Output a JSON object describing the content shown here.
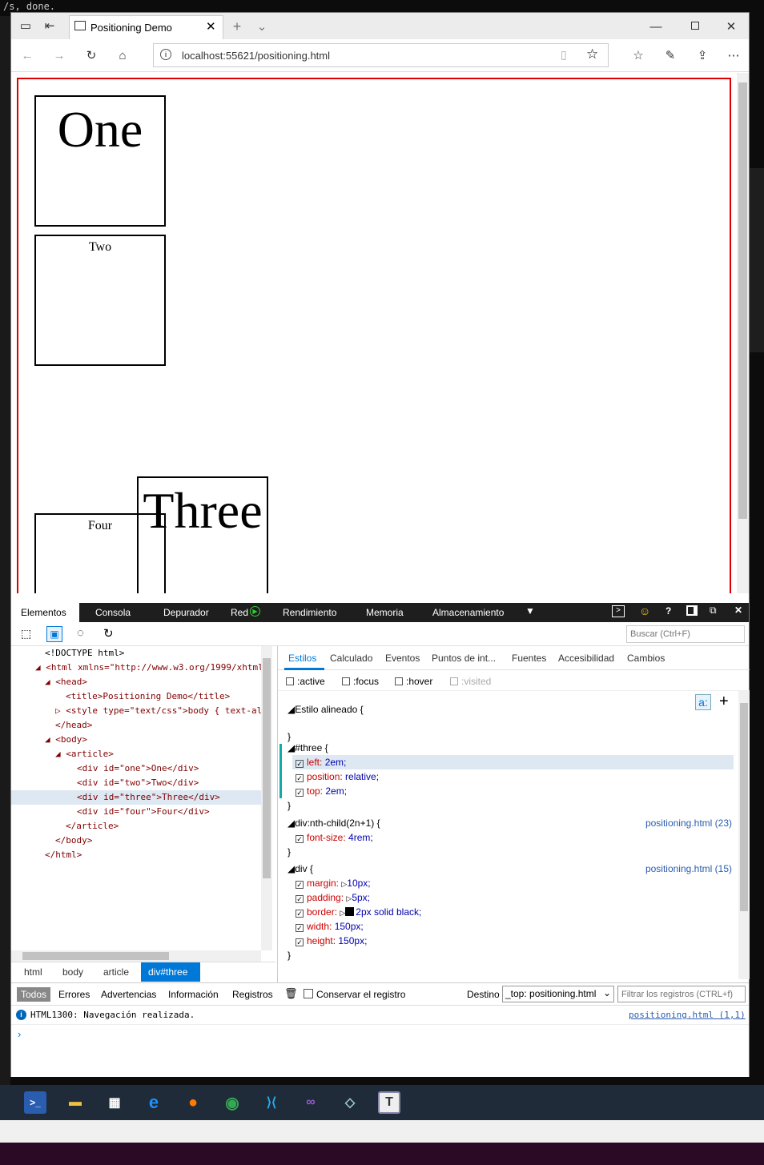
{
  "background": {
    "terminal_text": "/s, done."
  },
  "browser": {
    "tab_title": "Positioning Demo",
    "url": "localhost:55621/positioning.html"
  },
  "page": {
    "boxes": {
      "one": "One",
      "two": "Two",
      "three": "Three",
      "four": "Four"
    }
  },
  "devtools": {
    "tabs": [
      "Elementos",
      "Consola",
      "Depurador",
      "Red",
      "Rendimiento",
      "Memoria",
      "Almacenamiento"
    ],
    "search_placeholder": "Buscar (Ctrl+F)",
    "dom": [
      "<!DOCTYPE html>",
      "<html xmlns=\"http://www.w3.org/1999/xhtml",
      "<head>",
      "<title>Positioning Demo</title>",
      "<style type=\"text/css\">body { text-al",
      "</head>",
      "<body>",
      "<article>",
      "<div id=\"one\">One</div>",
      "<div id=\"two\">Two</div>",
      "<div id=\"three\">Three</div>",
      "<div id=\"four\">Four</div>",
      "</article>",
      "</body>",
      "</html>"
    ],
    "breadcrumb": [
      "html",
      "body",
      "article",
      "div#three"
    ],
    "style_tabs": [
      "Estilos",
      "Calculado",
      "Eventos",
      "Puntos de int...",
      "Fuentes",
      "Accesibilidad",
      "Cambios"
    ],
    "states": [
      ":active",
      ":focus",
      ":hover",
      ":visited"
    ],
    "rules": {
      "inline": "Estilo alineado  {",
      "three": {
        "selector": "#three  {",
        "props": [
          [
            "left:",
            "2em;"
          ],
          [
            "position:",
            "relative;"
          ],
          [
            "top:",
            "2em;"
          ]
        ]
      },
      "nth": {
        "selector": "div:nth-child(2n+1)  {",
        "source": "positioning.html (23)",
        "props": [
          [
            "font-size:",
            "4rem;"
          ]
        ]
      },
      "div": {
        "selector": "div  {",
        "source": "positioning.html (15)",
        "props": [
          [
            "margin:",
            "10px;"
          ],
          [
            "padding:",
            "5px;"
          ],
          [
            "border:",
            "2px solid black;"
          ],
          [
            "width:",
            "150px;"
          ],
          [
            "height:",
            "150px;"
          ]
        ]
      },
      "close": "}"
    },
    "console": {
      "filters": [
        "Todos",
        "Errores",
        "Advertencias",
        "Información",
        "Registros"
      ],
      "preserve": "Conservar el registro",
      "dest_label": "Destino",
      "dest_value": "_top: positioning.html",
      "filter_placeholder": "Filtrar los registros (CTRL+f)",
      "message": "HTML1300: Navegación realizada.",
      "message_source": "positioning.html (1,1)"
    }
  },
  "colors": {
    "accent": "#0078d7",
    "article_border": "#dd0000",
    "devtools_bar": "#1e1e1e"
  }
}
